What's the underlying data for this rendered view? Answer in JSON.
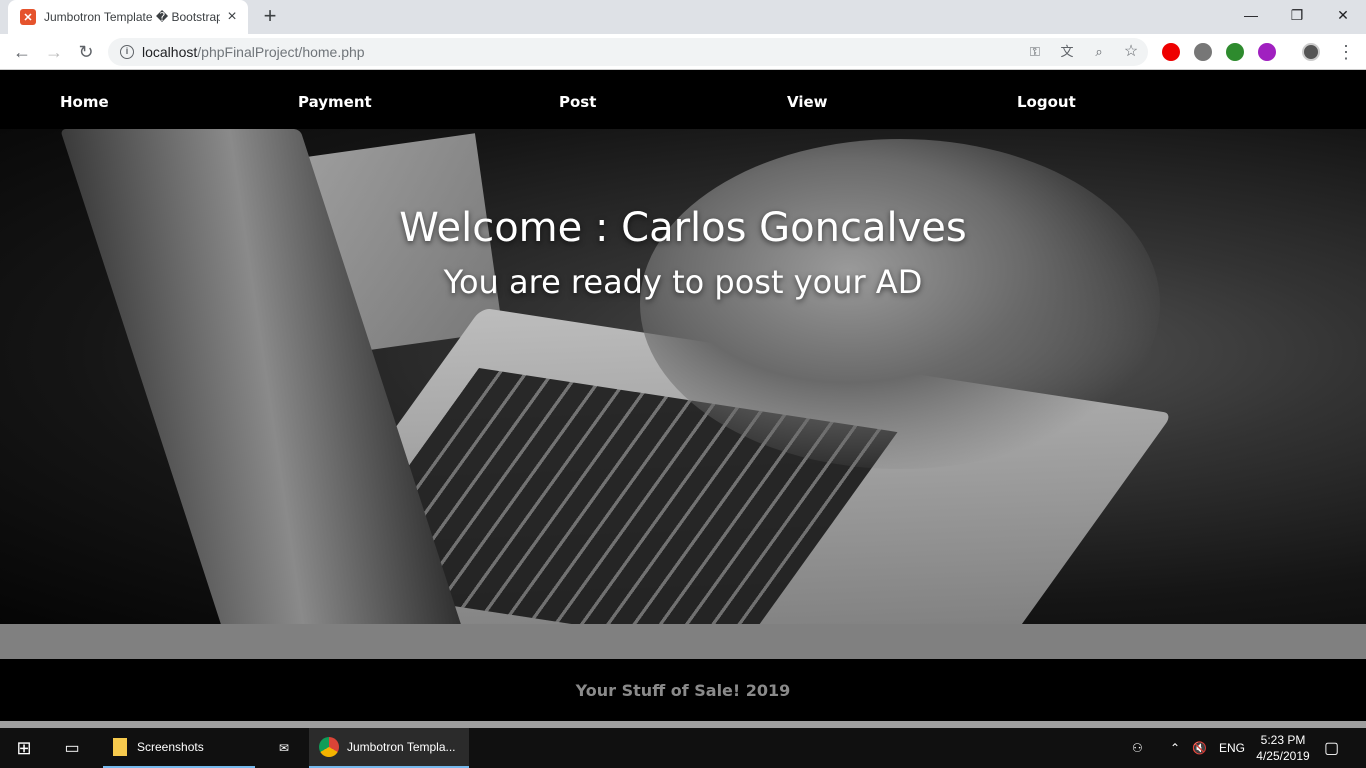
{
  "browser": {
    "tab_title": "Jumbotron Template � Bootstrap",
    "url_host": "localhost",
    "url_path": "/phpFinalProject/home.php",
    "new_tab": "+",
    "close": "✕"
  },
  "nav": {
    "home": "Home",
    "payment": "Payment",
    "post": "Post",
    "view": "View",
    "logout": "Logout"
  },
  "hero": {
    "welcome": "Welcome : Carlos Goncalves",
    "subtitle": "You are ready to post your AD"
  },
  "footer": {
    "text": "Your Stuff of Sale! 2019"
  },
  "taskbar": {
    "screenshots": "Screenshots",
    "chrome": "Jumbotron Templa...",
    "lang": "ENG",
    "time": "5:23 PM",
    "date": "4/25/2019"
  },
  "colors": {
    "accent": "#76b9ed",
    "favicon": "#e5532d"
  }
}
